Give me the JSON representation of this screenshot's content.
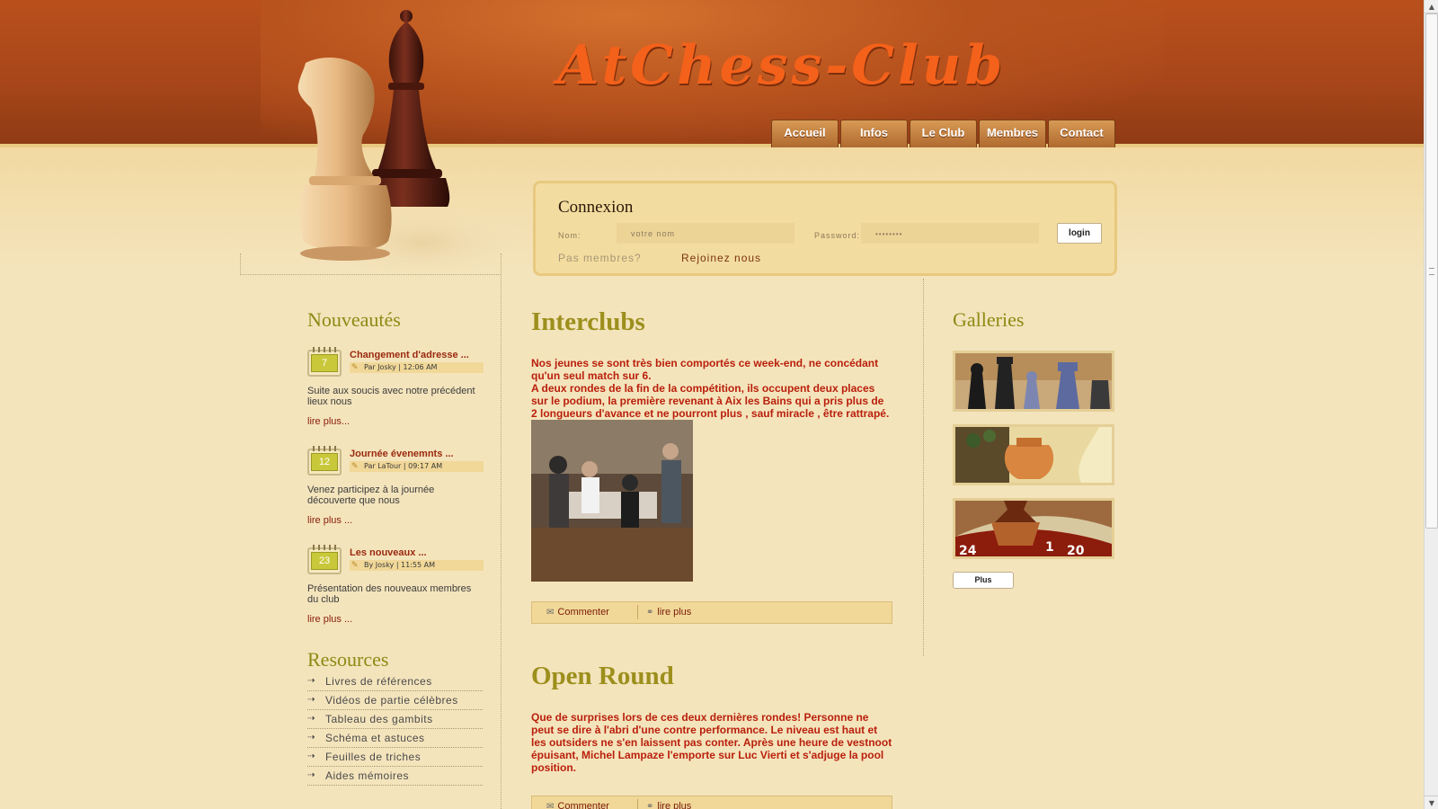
{
  "site": {
    "title": "AtChess-Club"
  },
  "nav": {
    "items": [
      {
        "label": "Accueil"
      },
      {
        "label": "Infos"
      },
      {
        "label": "Le Club"
      },
      {
        "label": "Membres"
      },
      {
        "label": "Contact"
      }
    ]
  },
  "login": {
    "title": "Connexion",
    "name_label": "Nom:",
    "name_placeholder": "votre nom",
    "password_label": "Password:",
    "password_value": "••••••••",
    "button_label": "login",
    "not_member_text": "Pas membres?",
    "join_link": "Rejoinez nous"
  },
  "news": {
    "title": "Nouveautés",
    "items": [
      {
        "day": "7",
        "title": "Changement d'adresse ...",
        "meta": "Par Josky | 12:06 AM",
        "excerpt": "Suite aux soucis avec notre précédent lieux nous",
        "more": "lire plus..."
      },
      {
        "day": "12",
        "title": "Journée évenemnts ...",
        "meta": "Par LaTour | 09:17 AM",
        "excerpt": "Venez participez à la journée découverte que nous",
        "more": "lire plus ..."
      },
      {
        "day": "23",
        "title": "Les nouveaux ...",
        "meta": "By Josky | 11:55 AM",
        "excerpt": "Présentation des nouveaux membres du club",
        "more": "lire plus ..."
      }
    ]
  },
  "resources": {
    "title": "Resources",
    "items": [
      {
        "label": "Livres de références"
      },
      {
        "label": "Vidéos de partie célèbres"
      },
      {
        "label": "Tableau des gambits"
      },
      {
        "label": "Schéma et astuces"
      },
      {
        "label": "Feuilles de triches"
      },
      {
        "label": "Aides mémoires"
      }
    ]
  },
  "posts": [
    {
      "title": "Interclubs",
      "body": "Nos jeunes se sont très bien comportés ce week-end, ne concédant qu'un seul match sur 6.\nA deux rondes de la fin de la compétition, ils occupent deux places sur le podium, la première revenant à Aix les Bains qui a pris plus de 2 longueurs d'avance et ne pourront plus , sauf miracle , être rattrapé.",
      "comment_label": "Commenter",
      "more_label": "lire plus"
    },
    {
      "title": "Open Round",
      "body": "Que de surprises lors de ces deux dernières rondes! Personne ne peut se dire à l'abri d'une contre performance. Le niveau est haut et les outsiders ne s'en laissent pas conter. Après une heure de vestnoot épuisant, Michel Lampaze l'emporte sur Luc Vierti et s'adjuge la pool position.",
      "comment_label": "Commenter",
      "more_label": "lire plus"
    }
  ],
  "galleries": {
    "title": "Galleries",
    "more_button": "Plus"
  },
  "colors": {
    "header": "#b9501c",
    "title_orange": "#f4611a",
    "heading_olive": "#8b8b14",
    "post_red": "#b9200c",
    "background": "#f4e4bc"
  }
}
